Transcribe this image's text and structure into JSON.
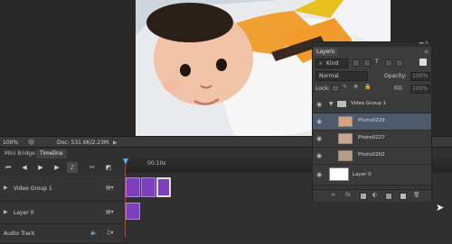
{
  "canvas": {
    "bg": "#282828"
  },
  "status": {
    "zoom": "100%",
    "doc": "Doc: 531.6K/2.23M"
  },
  "timeline": {
    "tabs": [
      "Mini Bridge",
      "Timeline"
    ],
    "active_tab": "Timeline",
    "ruler_label": "00:10s",
    "tracks": [
      {
        "name": "Video Group 1"
      },
      {
        "name": "Layer 0"
      },
      {
        "name": "Audio Track"
      }
    ]
  },
  "layers": {
    "title": "Layers",
    "filter_kind": "Kind",
    "blend_mode": "Normal",
    "opacity_label": "Opacity:",
    "opacity_value": "100%",
    "lock_label": "Lock:",
    "fill_label": "Fill:",
    "fill_value": "100%",
    "items": [
      {
        "name": "Video Group 1",
        "type": "group",
        "selected": false
      },
      {
        "name": "Photo0229",
        "type": "photo",
        "selected": true
      },
      {
        "name": "Photo0227",
        "type": "photo",
        "selected": false
      },
      {
        "name": "Photo0202",
        "type": "photo",
        "selected": false
      },
      {
        "name": "Layer 0",
        "type": "layer",
        "selected": false
      }
    ],
    "footer_icons": [
      "link-icon",
      "fx-icon",
      "mask-icon",
      "adjustment-icon",
      "folder-icon",
      "new-layer-icon",
      "trash-icon"
    ]
  },
  "colors": {
    "clip": "#7d3fbf",
    "selection": "#4c5a6c",
    "playhead": "#d23c3c"
  }
}
